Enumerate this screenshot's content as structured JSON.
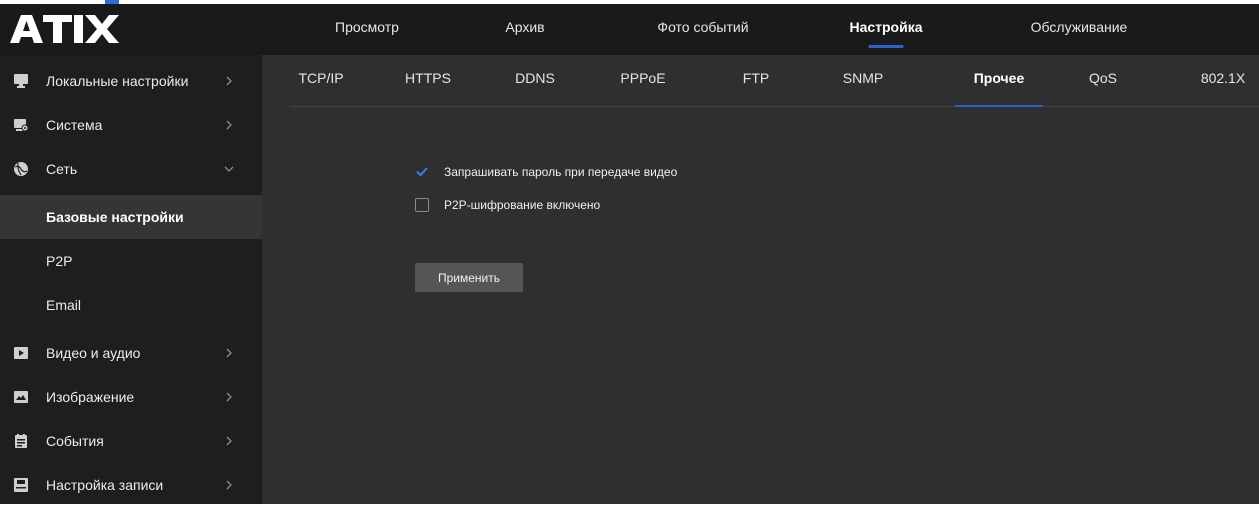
{
  "app": {
    "logo_text": "ATIX",
    "accent_color": "#2a62c9"
  },
  "top_nav": {
    "items": [
      {
        "label": "Просмотр",
        "active": false
      },
      {
        "label": "Архив",
        "active": false
      },
      {
        "label": "Фото событий",
        "active": false
      },
      {
        "label": "Настройка",
        "active": true
      },
      {
        "label": "Обслуживание",
        "active": false
      }
    ]
  },
  "sidebar": {
    "items": [
      {
        "label": "Локальные настройки",
        "icon": "monitor-icon",
        "expanded": false
      },
      {
        "label": "Система",
        "icon": "system-icon",
        "expanded": false
      },
      {
        "label": "Сеть",
        "icon": "network-icon",
        "expanded": true
      },
      {
        "label": "Видео и аудио",
        "icon": "video-icon",
        "expanded": false
      },
      {
        "label": "Изображение",
        "icon": "image-icon",
        "expanded": false
      },
      {
        "label": "События",
        "icon": "events-icon",
        "expanded": false
      },
      {
        "label": "Настройка записи",
        "icon": "record-icon",
        "expanded": false
      }
    ],
    "network_subitems": [
      {
        "label": "Базовые настройки",
        "active": true
      },
      {
        "label": "P2P",
        "active": false
      },
      {
        "label": "Email",
        "active": false
      }
    ]
  },
  "tabs": {
    "items": [
      {
        "label": "TCP/IP",
        "active": false
      },
      {
        "label": "HTTPS",
        "active": false
      },
      {
        "label": "DDNS",
        "active": false
      },
      {
        "label": "PPPoE",
        "active": false
      },
      {
        "label": "FTP",
        "active": false
      },
      {
        "label": "SNMP",
        "active": false
      },
      {
        "label": "Прочее",
        "active": true
      },
      {
        "label": "QoS",
        "active": false
      },
      {
        "label": "802.1X",
        "active": false
      }
    ]
  },
  "form": {
    "options": [
      {
        "label": "Запрашивать пароль при передаче видео",
        "checked": true
      },
      {
        "label": "P2P-шифрование включено",
        "checked": false
      }
    ],
    "apply_label": "Применить"
  }
}
